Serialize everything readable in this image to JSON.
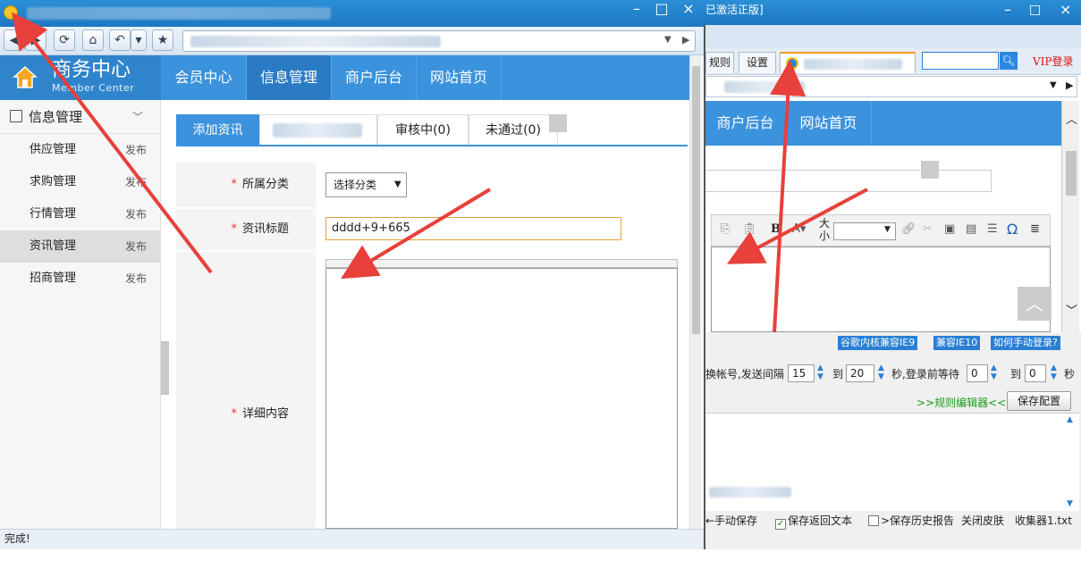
{
  "left_window": {
    "toolbar_icons": [
      "back-arrow-icon",
      "forward-arrow-icon",
      "refresh-icon",
      "home-icon",
      "undo-icon",
      "dropdown-icon",
      "star-icon"
    ],
    "logo": {
      "title": "商务中心",
      "subtitle": "Member Center"
    },
    "nav": [
      "会员中心",
      "信息管理",
      "商户后台",
      "网站首页"
    ],
    "sidebar": {
      "heading": "信息管理",
      "items": [
        {
          "label": "供应管理",
          "action": "发布"
        },
        {
          "label": "求购管理",
          "action": "发布"
        },
        {
          "label": "行情管理",
          "action": "发布"
        },
        {
          "label": "资讯管理",
          "action": "发布"
        },
        {
          "label": "招商管理",
          "action": "发布"
        }
      ]
    },
    "tabs": {
      "add": "添加资讯",
      "review": "审核中(0)",
      "rejected": "未通过(0)"
    },
    "form": {
      "category_label": "所属分类",
      "category_value": "选择分类",
      "title_label": "资讯标题",
      "title_value": "dddd+9+665",
      "content_label": "详细内容",
      "required_mark": "*"
    },
    "status": "完成!"
  },
  "right_window": {
    "title": "已激活正版]",
    "tabs": [
      "规则",
      "设置"
    ],
    "vip_login": "VIP登录",
    "nav": [
      "商户后台",
      "网站首页"
    ],
    "size_label": "大小",
    "bold": "B",
    "omega": "Ω",
    "badges": [
      "谷歌内核兼容IE9",
      "兼容IE10",
      "如何手动登录?"
    ],
    "timing": {
      "prefix": "换帐号,发送间隔",
      "interval_from": "15",
      "to1": "到",
      "interval_to": "20",
      "mid": "秒,登录前等待",
      "wait_from": "0",
      "to2": "到",
      "wait_to": "0",
      "suffix": "秒"
    },
    "rule_editor": ">>规则编辑器<<",
    "save_config": "保存配置",
    "bottom": {
      "manual_save": "←手动保存",
      "save_return": "保存返回文本",
      "save_history": ">保存历史报告",
      "close_skin": "关闭皮肤",
      "collector": "收集器1.txt"
    }
  },
  "colors": {
    "brand": "#3b92dd",
    "arrow": "#e8403a",
    "titlebar": "#1d77c2"
  }
}
